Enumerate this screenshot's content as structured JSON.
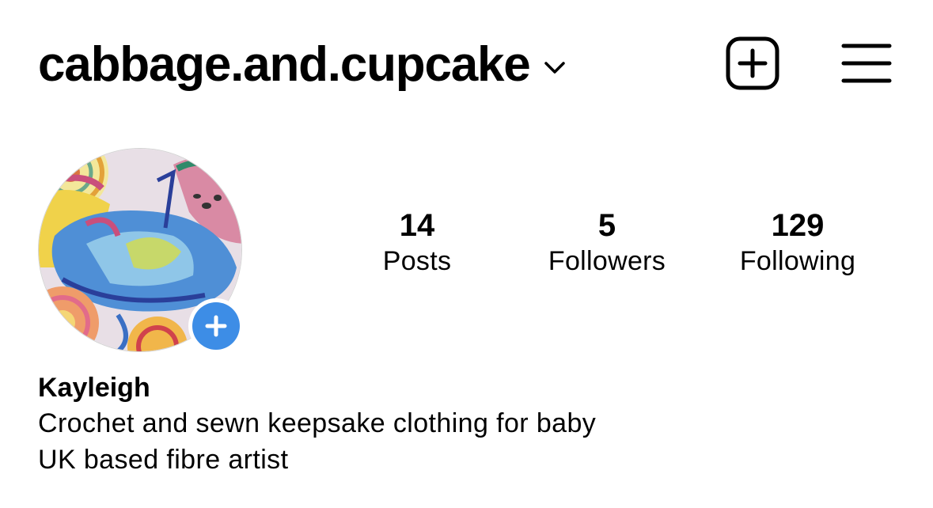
{
  "header": {
    "username": "cabbage.and.cupcake",
    "chevron_icon": "chevron-down-icon",
    "new_post_icon": "plus-square-icon",
    "menu_icon": "hamburger-menu-icon"
  },
  "profile": {
    "avatar_icon": "avatar",
    "add_story_icon": "plus-icon",
    "accent_color": "#3d8de6"
  },
  "stats": [
    {
      "value": "14",
      "label": "Posts"
    },
    {
      "value": "5",
      "label": "Followers"
    },
    {
      "value": "129",
      "label": "Following"
    }
  ],
  "bio": {
    "name": "Kayleigh",
    "lines": [
      "Crochet and sewn keepsake clothing for baby",
      "UK based fibre artist"
    ]
  }
}
